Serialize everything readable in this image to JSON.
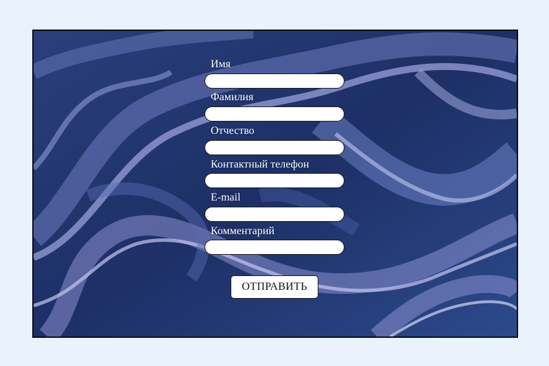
{
  "colors": {
    "page_background": "#eaf3fb",
    "swirl_dark": "#1b2d5e",
    "swirl_mid": "#3e5a9c",
    "swirl_light": "#8a90d0",
    "swirl_highlight": "#c6c8f0",
    "label_text": "#ffffff",
    "input_background": "#ffffff"
  },
  "background": {
    "description_icon": "marble-swirl-pattern"
  },
  "form": {
    "fields": [
      {
        "label": "Имя",
        "value": "",
        "placeholder": ""
      },
      {
        "label": "Фамилия",
        "value": "",
        "placeholder": ""
      },
      {
        "label": "Отчество",
        "value": "",
        "placeholder": ""
      },
      {
        "label": "Контактный телефон",
        "value": "",
        "placeholder": ""
      },
      {
        "label": "E-mail",
        "value": "",
        "placeholder": ""
      },
      {
        "label": "Комментарий",
        "value": "",
        "placeholder": ""
      }
    ],
    "submit_label": "ОТПРАВИТЬ"
  }
}
